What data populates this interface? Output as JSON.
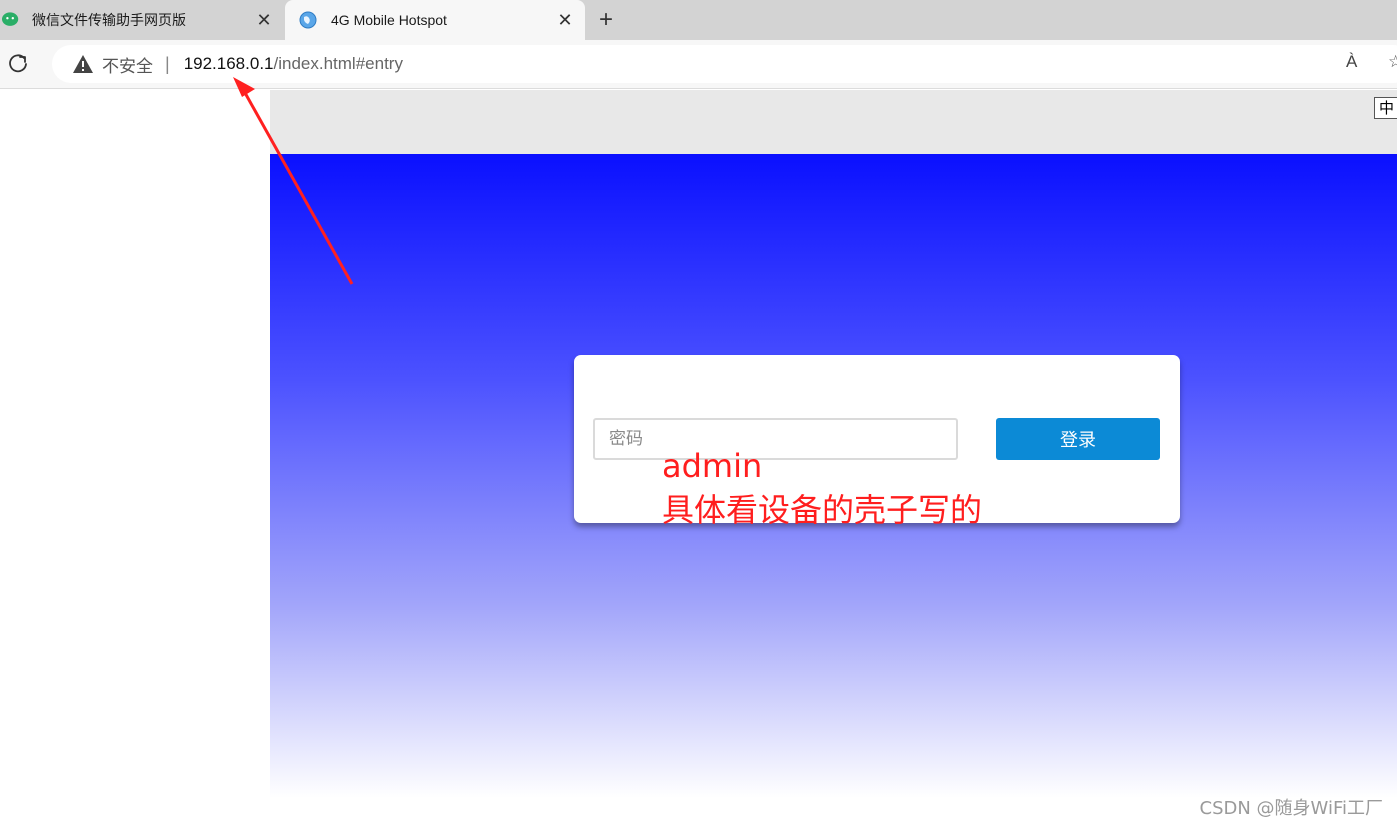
{
  "browser": {
    "tabs": [
      {
        "title": "微信文件传输助手网页版",
        "active": false,
        "icon": "wechat-icon"
      },
      {
        "title": "4G Mobile Hotspot",
        "active": true,
        "icon": "globe-icon"
      }
    ],
    "close_glyph": "✕",
    "new_tab_glyph": "+",
    "address": {
      "security_label": "不安全",
      "separator": "|",
      "url_host": "192.168.0.1",
      "url_path": "/index.html#entry"
    },
    "read_aloud_label": "À"
  },
  "page": {
    "language_button": "中",
    "login": {
      "password_placeholder": "密码",
      "submit_label": "登录"
    }
  },
  "annotation": {
    "line1": "admin",
    "line2": "具体看设备的壳子写的",
    "color": "#ff1e1e"
  },
  "watermark": "CSDN @随身WiFi工厂",
  "colors": {
    "gradient_top": "#0a10ff",
    "login_button": "#0c8ad6"
  }
}
